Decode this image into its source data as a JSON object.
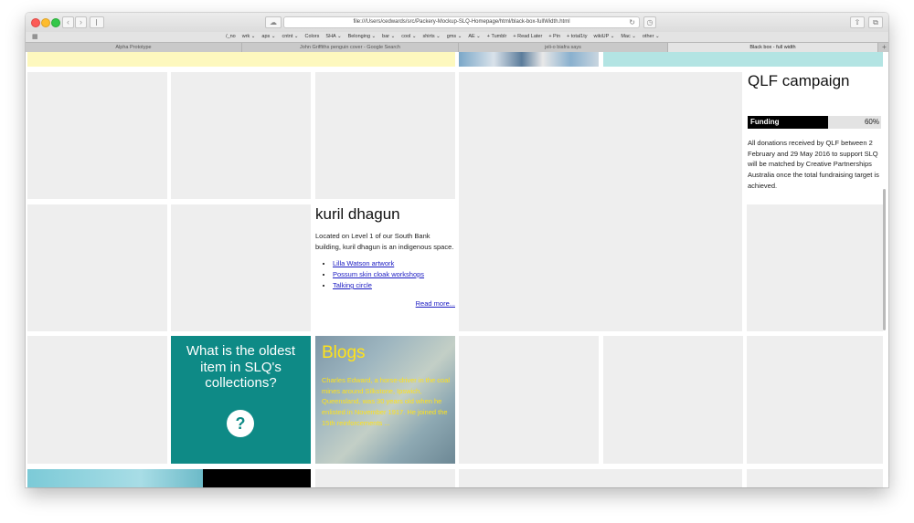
{
  "browser": {
    "url": "file:///Users/cedwards/src/Packery-Mockup-SLQ-Homepage/html/black-box-fullWidth.html",
    "bookmarks": [
      "/_no",
      "wrk ⌄",
      "aps ⌄",
      "cntnt ⌄",
      "Colors",
      "SHA ⌄",
      "Belonging ⌄",
      "bar ⌄",
      "cool ⌄",
      "shirts ⌄",
      "gms ⌄",
      "AE ⌄",
      "+ Tumblr",
      "+ Read Later",
      "+ Pin",
      "+ total1ty",
      "wikiUP ⌄",
      "Mac ⌄",
      "other ⌄"
    ],
    "tabs": [
      {
        "label": "Alpha Prototype",
        "active": false
      },
      {
        "label": "John Griffiths penguin cover - Google Search",
        "active": false
      },
      {
        "label": "jeli-o biafra says",
        "active": false
      },
      {
        "label": "Black box - full width",
        "active": true
      }
    ]
  },
  "qlf": {
    "title": "QLF campaign",
    "funding_label": "Funding",
    "funding_percent_text": "60%",
    "funding_fraction": 0.6,
    "description": "All donations received by QLF between 2 February and 29 May 2016 to support SLQ will be matched by Creative Partnerships Australia once the total fundraising target is achieved."
  },
  "kuril": {
    "title": "kuril dhagun",
    "description": "Located on Level 1 of our South Bank building, kuril dhagun is an indigenous space.",
    "links": [
      "Lilla Watson artwork",
      "Possum skin cloak workshops",
      "Talking circle"
    ],
    "read_more": "Read more..."
  },
  "question": {
    "text": "What is the oldest item in SLQ's collections?",
    "button": "?"
  },
  "blogs": {
    "title": "Blogs",
    "text": "Charles Edward, a horse-driver in the coal mines around Silkstone, Ipswich, Queensland, was 30 years old when he enlisted in November 1917. He joined the 15th reinforcements ..."
  }
}
